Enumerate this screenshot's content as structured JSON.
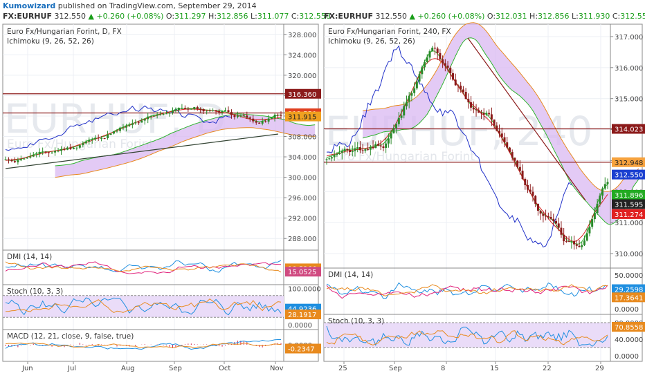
{
  "header": {
    "author": "Kumowizard",
    "published_text": "published on TradingView.com, September 29, 2014"
  },
  "left": {
    "symbol": "FX:EURHUF",
    "price": "312.550",
    "change": "▲ +0.260 (+0.08%)",
    "ohlc": {
      "o_label": "O:",
      "o": "311.297",
      "h_label": "H:",
      "h": "312.856",
      "l_label": "L:",
      "l": "311.077",
      "c_label": "C:",
      "c": "312.550"
    },
    "title": "Euro Fx/Hungarian Forint, D, FX",
    "indicator": "Ichimoku (9, 26, 52, 26)",
    "watermark_big": "EURHUF, D",
    "watermark_small": "Euro Fx/Hungarian Forint",
    "price_ticks": [
      "328.000",
      "324.000",
      "320.000",
      "316.000",
      "312.000",
      "308.000",
      "304.000",
      "300.000",
      "296.000",
      "292.000",
      "288.000"
    ],
    "badges": [
      "316.360",
      "312.550",
      "311.915"
    ],
    "x_ticks": [
      "Jun",
      "Jul",
      "Aug",
      "Sep",
      "Oct",
      "Nov"
    ],
    "dmi": {
      "label": "DMI (14, 14)",
      "badges": [
        "18.5266",
        "15.0525"
      ]
    },
    "stoch": {
      "label": "Stoch (10, 3, 3)",
      "ticks": [
        "100.0000",
        "0.0000"
      ],
      "badges": [
        "44.9236",
        "28.1917"
      ]
    },
    "macd": {
      "label": "MACD (12, 21, close, 9, false, true)",
      "ticks": [
        "0.0000"
      ],
      "badges": [
        "-0.2347"
      ]
    }
  },
  "right": {
    "symbol": "FX:EURHUF",
    "price": "312.550",
    "change": "▲ +0.260 (+0.08%)",
    "ohlc": {
      "o_label": "O:",
      "o": "312.031",
      "h_label": "H:",
      "h": "312.856",
      "l_label": "L:",
      "l": "311.930",
      "c_label": "C:",
      "c": "312.550"
    },
    "title": "Euro Fx/Hungarian Forint, 240, FX",
    "indicator": "Ichimoku (9, 26, 52, 26)",
    "watermark_big": "EURHUF, 240",
    "watermark_small": "Euro Fx/Hungarian Forint",
    "price_ticks": [
      "317.000",
      "316.000",
      "315.000",
      "314.000",
      "313.000",
      "312.000",
      "311.000",
      "310.000"
    ],
    "badges": [
      "314.023",
      "312.948",
      "312.550",
      "311.896",
      "311.595",
      "311.274"
    ],
    "x_ticks": [
      "25",
      "Sep",
      "8",
      "15",
      "22",
      "29"
    ],
    "dmi": {
      "label": "DMI (14, 14)",
      "ticks": [
        "50.0000",
        "0.0000"
      ],
      "badges": [
        "29.2598",
        "17.3641"
      ]
    },
    "stoch": {
      "label": "Stoch (10, 3, 3)",
      "ticks": [
        "80.0000",
        "40.0000",
        "0.0000"
      ],
      "badges": [
        "70.8558"
      ]
    }
  },
  "colors": {
    "cloud": "#d9b8f2",
    "tenkan": "#d62020",
    "kijun": "#8b1a1a",
    "chikou": "#1f2fc8",
    "spanA": "#2fb52f",
    "spanB": "#e88a1e",
    "bull": "#2a8a2a",
    "bear": "#8b1a1a",
    "dmi_plus": "#1f8fe0",
    "dmi_minus": "#e0207a",
    "adx": "#e88a1e",
    "stoch_fill": "#eadcf8",
    "macd_line": "#1f8fe0",
    "macd_signal": "#e88a1e",
    "macd_hist": "#d02050"
  },
  "chart_data": [
    {
      "type": "line",
      "title": "Euro Fx/Hungarian Forint, D, FX",
      "subtitle": "Ichimoku (9, 26, 52, 26)",
      "categories": [
        "Jun",
        "Jul",
        "Aug",
        "Sep",
        "Oct",
        "Nov"
      ],
      "ylim": [
        286,
        330
      ],
      "series": [
        {
          "values": [
            303,
            305,
            309,
            313,
            312.5,
            312.6
          ]
        }
      ]
    },
    {
      "type": "line",
      "title": "Euro Fx/Hungarian Forint, 240, FX",
      "subtitle": "Ichimoku (9, 26, 52, 26)",
      "categories": [
        "25",
        "Sep",
        "8",
        "15",
        "22",
        "29"
      ],
      "ylim": [
        309.6,
        317.4
      ],
      "series": [
        {
          "values": [
            313.2,
            313.3,
            316.7,
            314.8,
            311.0,
            312.5
          ]
        }
      ]
    }
  ]
}
